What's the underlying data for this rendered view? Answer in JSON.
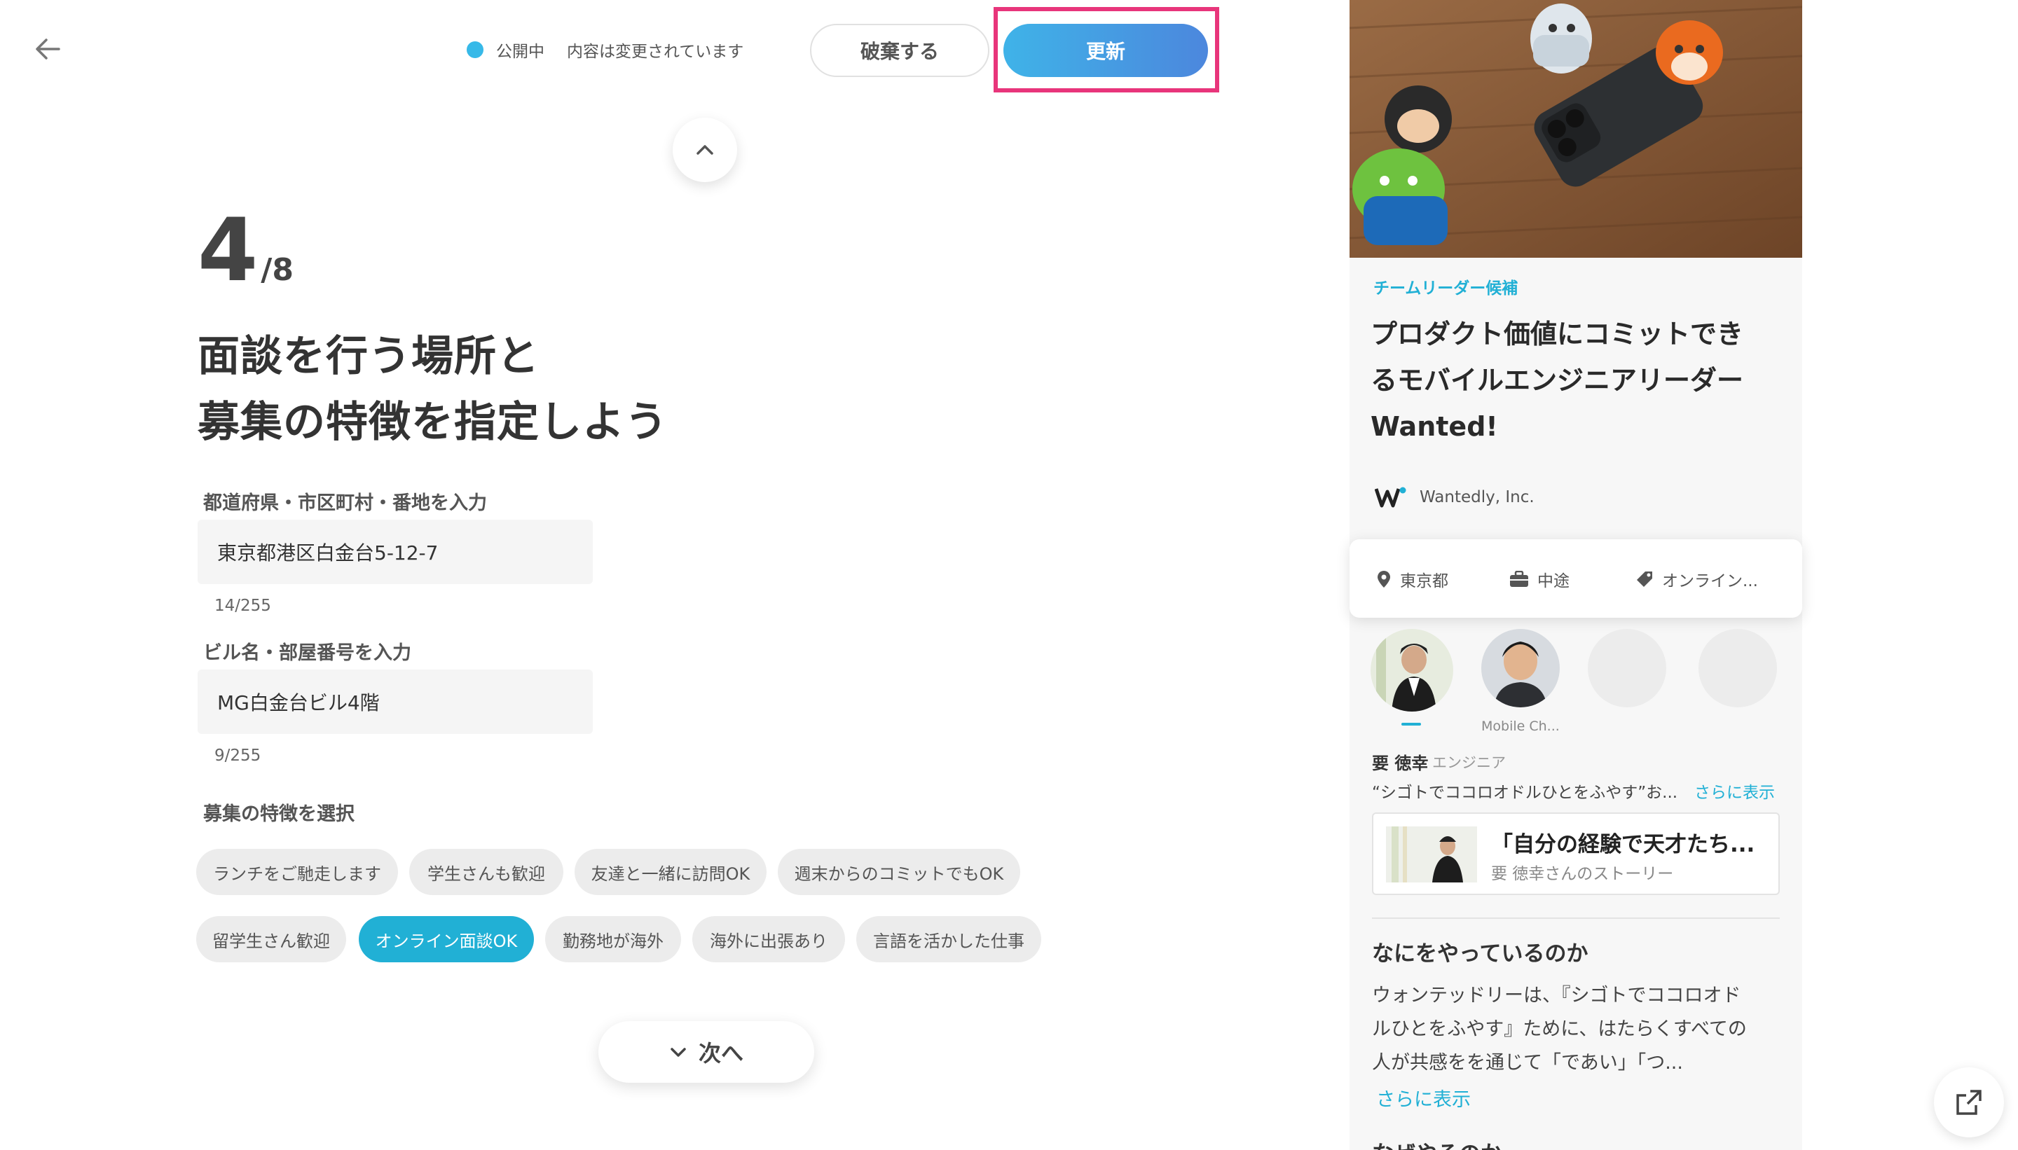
{
  "header": {
    "status_label": "公開中",
    "status_note": "内容は変更されています",
    "discard_label": "破棄する",
    "update_label": "更新"
  },
  "step": {
    "current": "4",
    "total": "/8"
  },
  "title": {
    "line1": "面談を行う場所と",
    "line2": "募集の特徴を指定しよう"
  },
  "form": {
    "address": {
      "label": "都道府県・市区町村・番地を入力",
      "value": "東京都港区白金台5-12-7",
      "count": "14/255"
    },
    "building": {
      "label": "ビル名・部屋番号を入力",
      "value": "MG白金台ビル4階",
      "count": "9/255"
    },
    "features_label": "募集の特徴を選択",
    "features": [
      {
        "label": "ランチをご馳走します",
        "active": false
      },
      {
        "label": "学生さんも歓迎",
        "active": false
      },
      {
        "label": "友達と一緒に訪問OK",
        "active": false
      },
      {
        "label": "週末からのコミットでもOK",
        "active": false
      },
      {
        "label": "留学生さん歓迎",
        "active": false
      },
      {
        "label": "オンライン面談OK",
        "active": true
      },
      {
        "label": "勤務地が海外",
        "active": false
      },
      {
        "label": "海外に出張あり",
        "active": false
      },
      {
        "label": "言語を活かした仕事",
        "active": false
      }
    ]
  },
  "next_label": "次へ",
  "preview": {
    "tag": "チームリーダー候補",
    "title_line1": "プロダクト価値にコミットでき",
    "title_line2": "るモバイルエンジニアリーダー",
    "title_line3": "Wanted!",
    "company": "Wantedly, Inc.",
    "info": {
      "location": "東京都",
      "employment": "中途",
      "feature": "オンライン..."
    },
    "avatar_caption": "Mobile Ch...",
    "member": {
      "name": "要 徳幸",
      "role": "エンジニア",
      "quote": "“シゴトでココロオドルひとをふやす”お...",
      "show_more": "さらに表示"
    },
    "story": {
      "title": "「自分の経験で天才たち...",
      "subtitle": "要 徳幸さんのストーリー"
    },
    "section": {
      "title": "なにをやっているのか",
      "line1": "ウォンテッドリーは、『シゴトでココロオド",
      "line2": "ルひとをふやす』ために、はたらくすべての",
      "line3": "人が共感をを通じて「であい」「つ...",
      "show_more": "さらに表示",
      "next_heading": "なぜやるのか"
    }
  },
  "colors": {
    "accent": "#21b0d5",
    "update_gradient_start": "#3fb3e8",
    "update_gradient_end": "#4c87dd",
    "highlight": "#e8357b",
    "status_dot": "#37b9e8"
  }
}
